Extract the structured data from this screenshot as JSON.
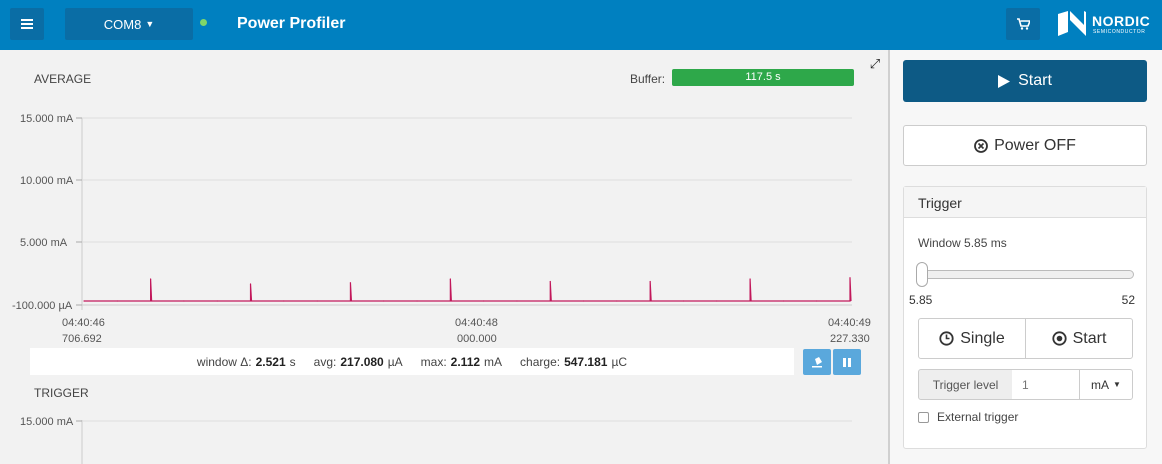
{
  "header": {
    "port_label": "COM8",
    "app_title": "Power Profiler",
    "logo_name": "NORDIC",
    "logo_sub": "SEMICONDUCTOR",
    "accent": "#0080c0",
    "connected_color": "#7fd66a"
  },
  "average": {
    "label": "AVERAGE",
    "buffer_label": "Buffer:",
    "buffer_value": "117.5 s",
    "buffer_fill": 1.0,
    "y_ticks": [
      "15.000 mA",
      "10.000 mA",
      "5.000 mA",
      "-100.000 µA"
    ],
    "x_ticks": [
      {
        "time": "04:40:46",
        "sub": "706.692"
      },
      {
        "time": "04:40:48",
        "sub": "000.000"
      },
      {
        "time": "04:40:49",
        "sub": "227.330"
      }
    ],
    "line_color": "#c2185b",
    "stats": {
      "window_label": "window Δ:",
      "window_value": "2.521",
      "window_unit": "s",
      "avg_label": "avg:",
      "avg_value": "217.080",
      "avg_unit": "µA",
      "max_label": "max:",
      "max_value": "2.112",
      "max_unit": "mA",
      "charge_label": "charge:",
      "charge_value": "547.181",
      "charge_unit": "µC"
    }
  },
  "trigger_chart": {
    "label": "TRIGGER",
    "y_ticks": [
      "15.000 mA"
    ]
  },
  "sidebar": {
    "start_label": "Start",
    "power_off_label": "Power OFF",
    "trigger": {
      "title": "Trigger",
      "window_label": "Window 5.85 ms",
      "slider_min": "5.85",
      "slider_max": "52",
      "single_label": "Single",
      "start_label": "Start",
      "level_label": "Trigger level",
      "level_placeholder": "1",
      "unit": "mA",
      "external_label": "External trigger"
    }
  },
  "chart_data": {
    "type": "line",
    "title": "",
    "xlabel": "",
    "ylabel": "",
    "x_range": [
      "04:40:46.706692",
      "04:40:49.227330"
    ],
    "ylim": [
      -0.1,
      15.0
    ],
    "y_unit": "mA",
    "series": [
      {
        "values_mA": [
          0.22,
          0.22,
          2.0,
          0.22,
          0.22,
          1.6,
          0.22,
          0.22,
          1.7,
          0.22,
          0.22,
          2.0,
          0.22,
          0.22,
          1.8,
          0.22,
          0.22,
          1.8,
          0.22,
          0.22,
          2.0,
          0.22,
          0.22,
          2.1
        ]
      }
    ],
    "grid": true
  }
}
